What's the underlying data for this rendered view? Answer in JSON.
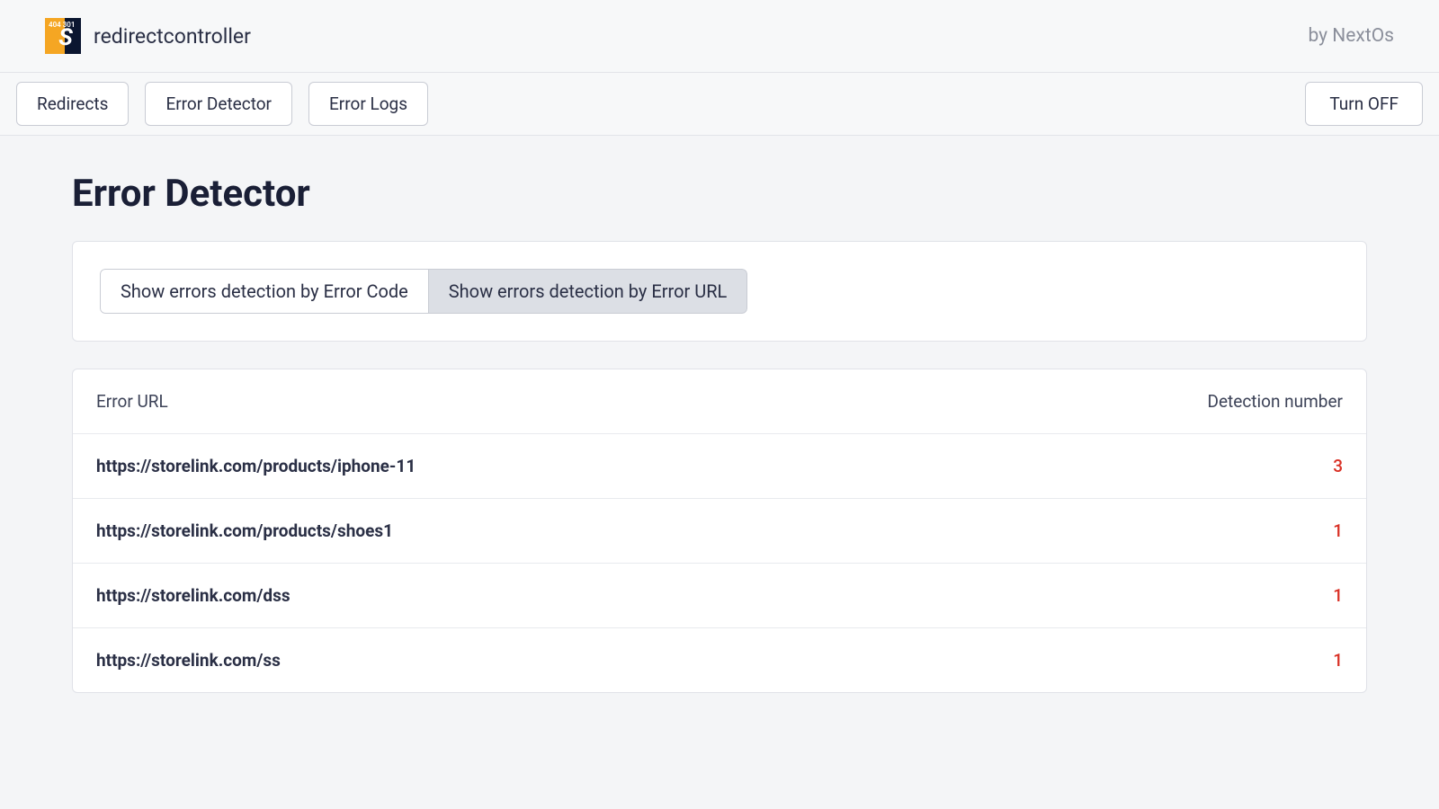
{
  "header": {
    "brand": "redirectcontroller",
    "byline": "by NextOs",
    "logo_codes": "404\n301"
  },
  "nav": {
    "tabs": [
      {
        "label": "Redirects"
      },
      {
        "label": "Error Detector"
      },
      {
        "label": "Error Logs"
      }
    ],
    "turnoff": "Turn OFF"
  },
  "page": {
    "title": "Error Detector"
  },
  "segmented": {
    "by_code": "Show errors detection by Error Code",
    "by_url": "Show errors detection by Error URL"
  },
  "table": {
    "col_url": "Error URL",
    "col_count": "Detection number",
    "rows": [
      {
        "url": "https://storelink.com/products/iphone-11",
        "count": "3"
      },
      {
        "url": "https://storelink.com/products/shoes1",
        "count": "1"
      },
      {
        "url": "https://storelink.com/dss",
        "count": "1"
      },
      {
        "url": "https://storelink.com/ss",
        "count": "1"
      }
    ]
  }
}
